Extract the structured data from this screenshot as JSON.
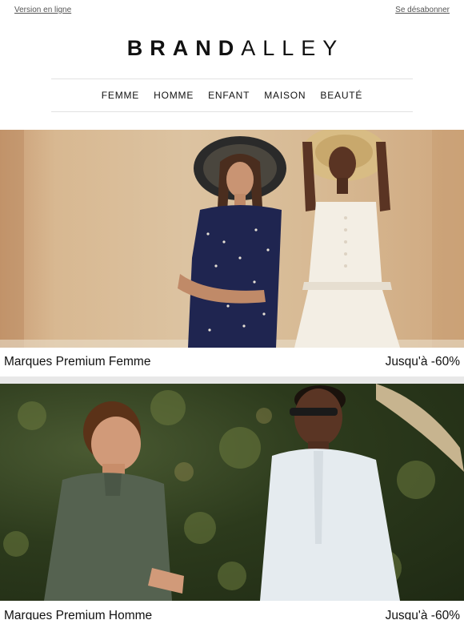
{
  "header": {
    "online_version": "Version en ligne",
    "unsubscribe": "Se désabonner",
    "logo_bold": "BRAND",
    "logo_light": "ALLEY"
  },
  "nav": {
    "items": [
      "FEMME",
      "HOMME",
      "ENFANT",
      "MAISON",
      "BEAUTÉ"
    ]
  },
  "promos": [
    {
      "title": "Marques Premium Femme",
      "discount": "Jusqu'à -60%"
    },
    {
      "title": "Marques Premium Homme",
      "discount": "Jusqu'à -60%"
    }
  ],
  "colors": {
    "text": "#111111",
    "separator": "#e8e8e8",
    "rule": "#e1e1e1"
  }
}
